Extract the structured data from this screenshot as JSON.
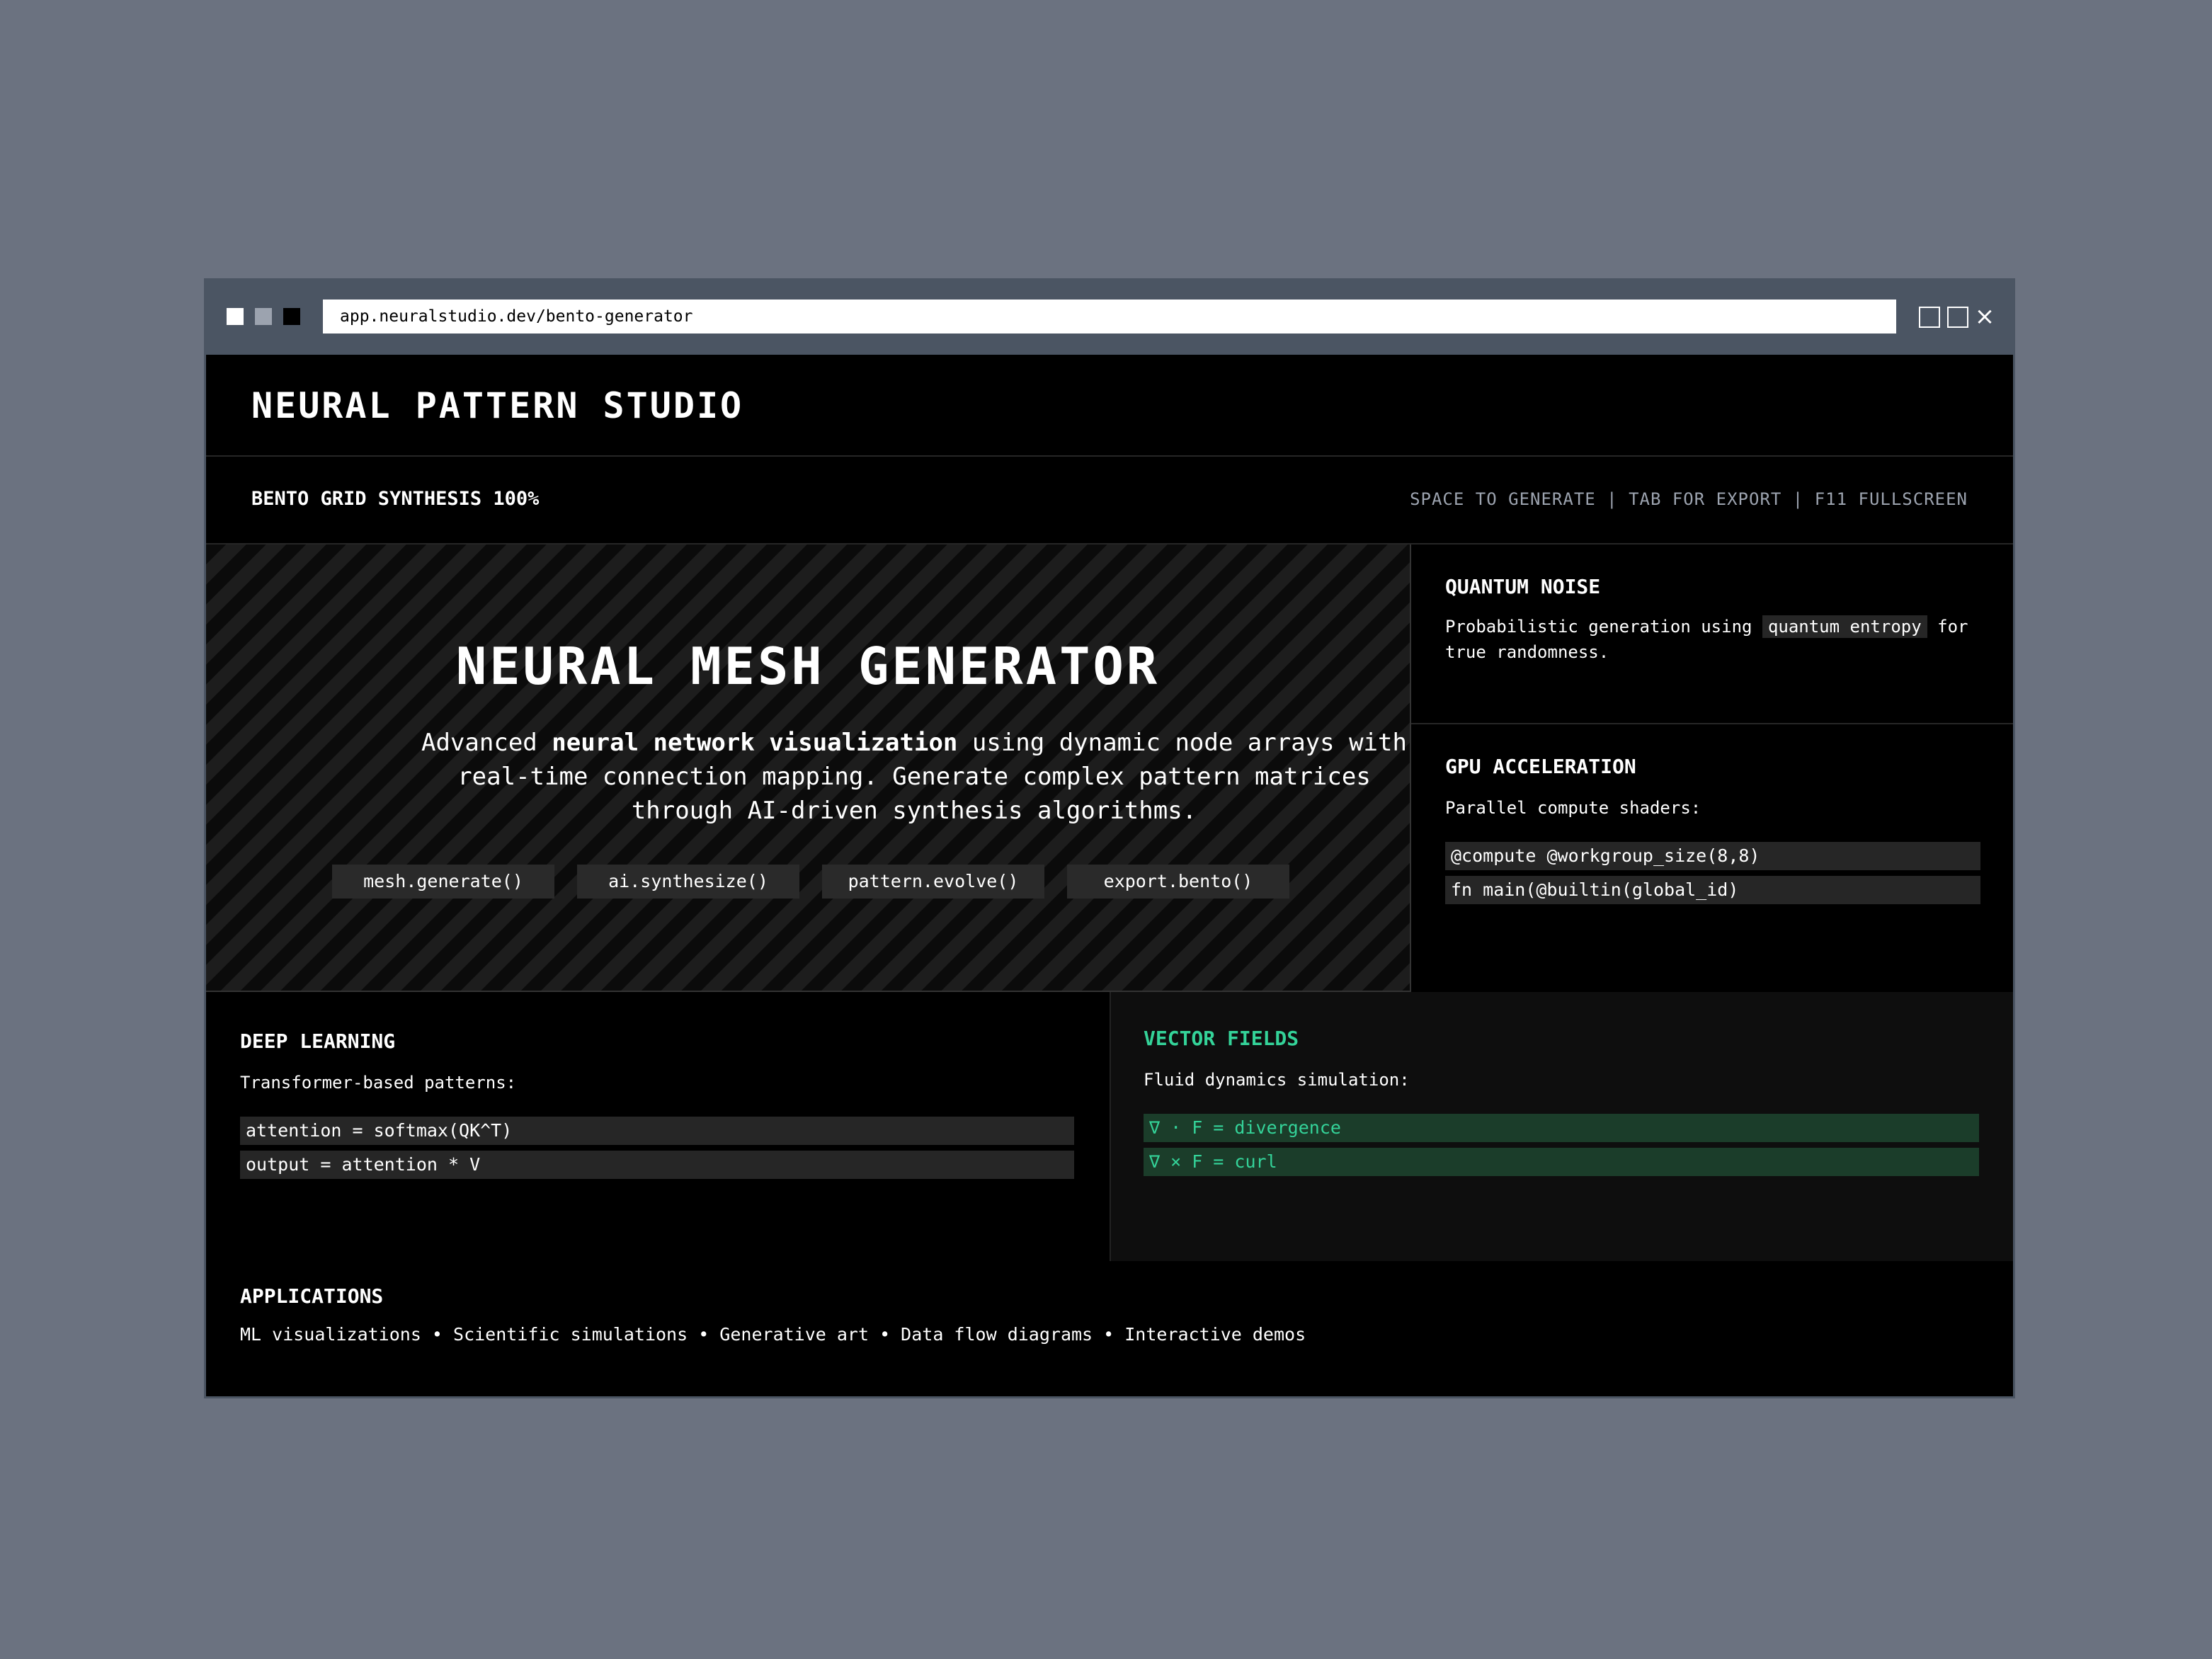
{
  "browser": {
    "url": "app.neuralstudio.dev/bento-generator",
    "close_glyph": "×"
  },
  "header": {
    "title": "NEURAL PATTERN STUDIO"
  },
  "status": {
    "left": "BENTO GRID SYNTHESIS 100%",
    "right": "SPACE TO GENERATE | TAB FOR EXPORT | F11 FULLSCREEN"
  },
  "hero": {
    "title": "NEURAL MESH GENERATOR",
    "desc_pre": "Advanced ",
    "desc_bold": "neural network visualization",
    "desc_post": " using dynamic node arrays with real-time connection mapping. Generate complex pattern matrices through AI-driven synthesis algorithms.",
    "commands": [
      "mesh.generate()",
      "ai.synthesize()",
      "pattern.evolve()",
      "export.bento()"
    ]
  },
  "quantum": {
    "title": "QUANTUM NOISE",
    "text_pre": "Probabilistic generation using ",
    "text_chip": "quantum entropy",
    "text_post": " for true randomness."
  },
  "gpu": {
    "title": "GPU ACCELERATION",
    "text": "Parallel compute shaders:",
    "code": [
      "@compute @workgroup_size(8,8)",
      "fn main(@builtin(global_id)"
    ]
  },
  "deep_learning": {
    "title": "DEEP LEARNING",
    "text": "Transformer-based patterns:",
    "code": [
      "attention = softmax(QK^T)",
      "output = attention * V"
    ]
  },
  "vector_fields": {
    "title": "VECTOR FIELDS",
    "text": "Fluid dynamics simulation:",
    "code": [
      "∇ · F = divergence",
      "∇ × F = curl"
    ]
  },
  "applications": {
    "title": "APPLICATIONS",
    "list": "ML visualizations • Scientific simulations • Generative art • Data flow diagrams • Interactive demos"
  }
}
